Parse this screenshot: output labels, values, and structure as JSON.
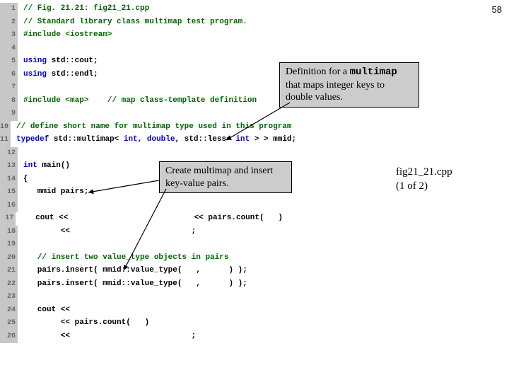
{
  "pageNumber": "58",
  "sideLabel": {
    "file": "fig21_21.cpp",
    "part": "(1 of 2)"
  },
  "callouts": {
    "c1": {
      "l1a": "Definition for a ",
      "l1b": "multimap",
      "l2": "that maps integer keys to",
      "l3": "double values."
    },
    "c2": {
      "l1": "Create multimap and insert",
      "l2": "key-value pairs."
    }
  },
  "code": {
    "l1": "// Fig. 21.21: fig21_21.cpp",
    "l2": "// Standard library class multimap test program.",
    "l3a": "#include ",
    "l3b": "<iostream>",
    "l5a": "using",
    "l5b": " std::cout;",
    "l6a": "using",
    "l6b": " std::endl;",
    "l8a": "#include ",
    "l8b": "<map>",
    "l8c": "    // map class-template definition",
    "l10": "// define short name for multimap type used in this program",
    "l11a": "typedef",
    "l11b": " std::multimap< ",
    "l11c": "int",
    "l11d": ", ",
    "l11e": "double",
    "l11f": ", std::less< ",
    "l11g": "int",
    "l11h": " > > mmid;",
    "l13a": "int",
    "l13b": " main()",
    "l14": "{",
    "l15": "   mmid pairs;",
    "l17a": "   cout << ",
    "l17b": "                         ",
    "l17c": " << pairs.count(   )",
    "l18a": "        << ",
    "l18b": "                         ",
    "l18c": ";",
    "l20": "   // insert two value_type objects in pairs",
    "l21a": "   pairs.insert( mmid::value_type(   , ",
    "l21b": "    ",
    "l21c": " ) );",
    "l22a": "   pairs.insert( mmid::value_type(   , ",
    "l22b": "    ",
    "l22c": " ) );",
    "l24a": "   cout << ",
    "l24b": " ",
    "l25a": "        << pairs.count(   )",
    "l26a": "        << ",
    "l26b": "                         ",
    "l26c": ";"
  }
}
